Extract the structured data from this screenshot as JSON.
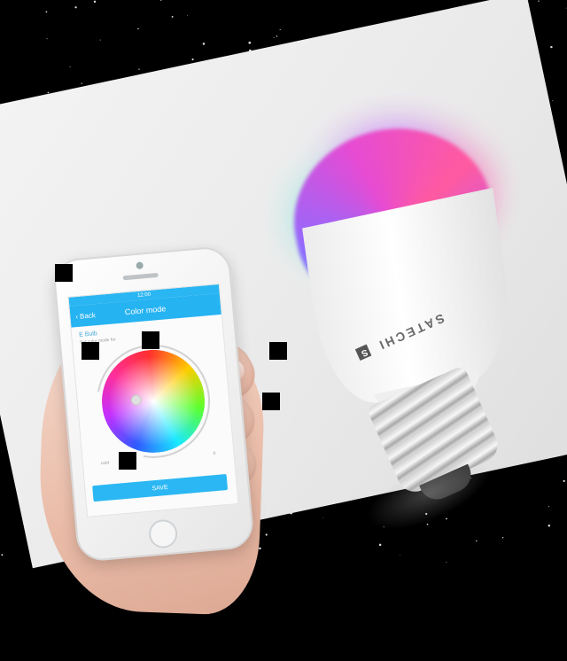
{
  "phone_app": {
    "status_time": "12:00",
    "header_back_label": "Back",
    "header_title": "Color mode",
    "device_name": "E Bulb",
    "hint_text": "Set color mode for",
    "left_slider_label": "cold",
    "right_slider_label": "0",
    "save_label": "SAVE"
  },
  "bulb": {
    "brand_text": "SATECHI",
    "brand_mark": "S"
  },
  "colors": {
    "app_blue": "#26b3f2",
    "glow_teal": "#43f0d6",
    "glow_purple": "#b94cff",
    "glow_pink": "#ff4da6"
  }
}
